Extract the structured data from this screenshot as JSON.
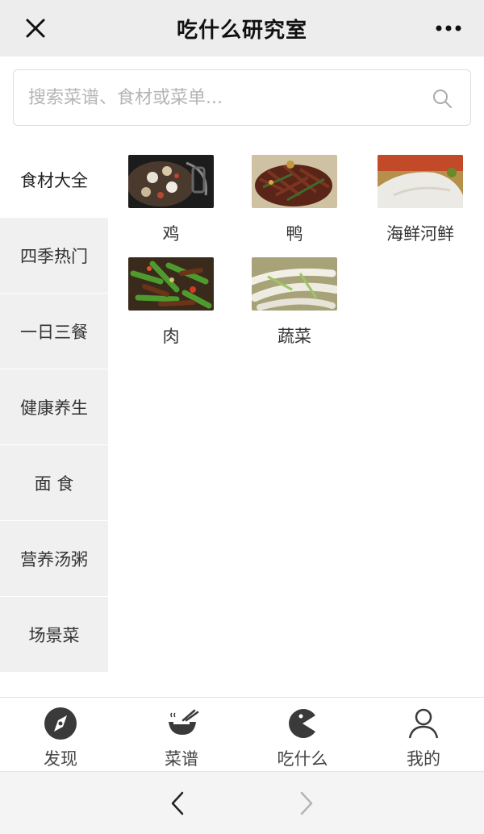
{
  "header": {
    "title": "吃什么研究室",
    "close_icon": "close-icon",
    "more_icon": "more-icon"
  },
  "search": {
    "placeholder": "搜索菜谱、食材或菜单...",
    "value": "",
    "icon": "search-icon"
  },
  "sidebar": {
    "items": [
      {
        "label": "食材大全",
        "active": true
      },
      {
        "label": "四季热门",
        "active": false
      },
      {
        "label": "一日三餐",
        "active": false
      },
      {
        "label": "健康养生",
        "active": false
      },
      {
        "label": "面 食",
        "active": false
      },
      {
        "label": "营养汤粥",
        "active": false
      },
      {
        "label": "场景菜",
        "active": false
      }
    ]
  },
  "categories": [
    {
      "label": "鸡",
      "image": "chicken-dish-photo"
    },
    {
      "label": "鸭",
      "image": "duck-dish-photo"
    },
    {
      "label": "海鲜河鲜",
      "image": "seafood-dish-photo"
    },
    {
      "label": "肉",
      "image": "meat-dish-photo"
    },
    {
      "label": "蔬菜",
      "image": "vegetable-dish-photo"
    }
  ],
  "tabbar": {
    "tabs": [
      {
        "label": "发现",
        "icon": "compass-icon"
      },
      {
        "label": "菜谱",
        "icon": "bowl-icon"
      },
      {
        "label": "吃什么",
        "icon": "pacman-icon"
      },
      {
        "label": "我的",
        "icon": "user-icon"
      }
    ]
  },
  "navbar": {
    "back_icon": "chevron-left-icon",
    "forward_icon": "chevron-right-icon"
  },
  "colors": {
    "header_bg": "#ededed",
    "sidebar_bg": "#f0f0f0",
    "text": "#333333"
  }
}
